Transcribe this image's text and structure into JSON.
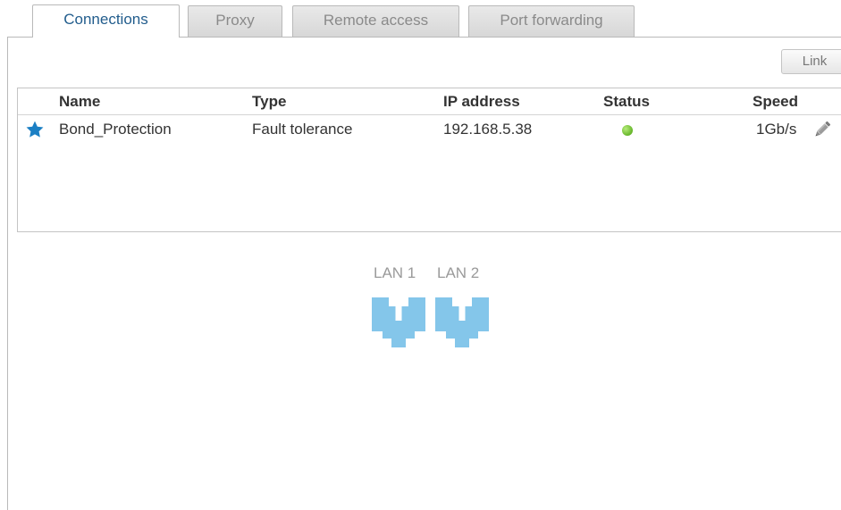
{
  "tabs": [
    {
      "label": "Connections",
      "active": true
    },
    {
      "label": "Proxy",
      "active": false
    },
    {
      "label": "Remote access",
      "active": false
    },
    {
      "label": "Port forwarding",
      "active": false
    }
  ],
  "toolbar": {
    "link_label": "Link"
  },
  "table": {
    "columns": [
      "Name",
      "Type",
      "IP address",
      "Status",
      "Speed"
    ],
    "rows": [
      {
        "icon": "star-icon",
        "name": "Bond_Protection",
        "type": "Fault tolerance",
        "ip": "192.168.5.38",
        "status_icon": "status-green-dot",
        "speed": "1Gb/s",
        "action_icon": "pencil-icon"
      }
    ]
  },
  "lan_ports": [
    {
      "label": "LAN 1",
      "icon": "ethernet-port-icon"
    },
    {
      "label": "LAN 2",
      "icon": "ethernet-port-icon"
    }
  ],
  "colors": {
    "active_tab_text": "#225d8d",
    "star": "#1b7fc4",
    "status_ok": "#66b52a",
    "port_fill": "#84c6ea"
  }
}
